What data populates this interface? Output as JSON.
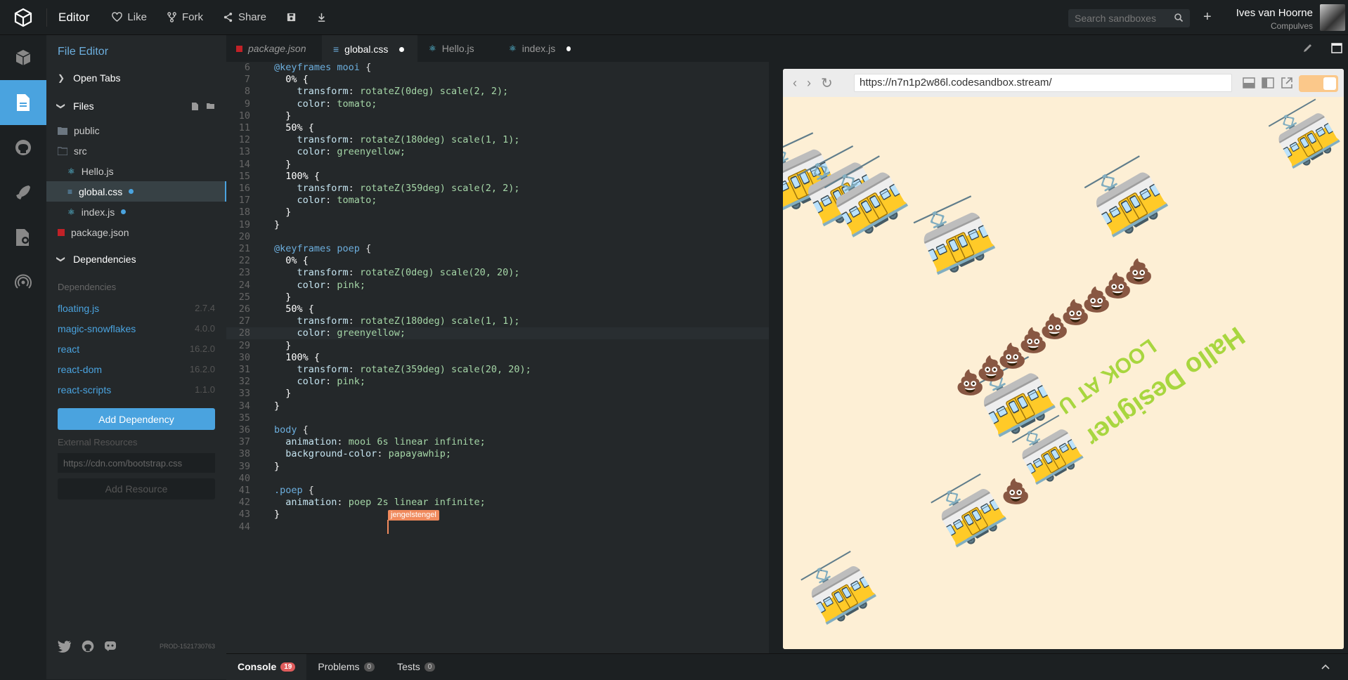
{
  "header": {
    "app_title": "Editor",
    "like": "Like",
    "fork": "Fork",
    "share": "Share",
    "search_placeholder": "Search sandboxes",
    "plus": "+",
    "user_name": "Ives van Hoorne",
    "user_org": "Compulves"
  },
  "sidebar": {
    "title": "File Editor",
    "open_tabs": "Open Tabs",
    "files": "Files",
    "file_items": [
      {
        "name": "public"
      },
      {
        "name": "src"
      },
      {
        "name": "Hello.js"
      },
      {
        "name": "global.css"
      },
      {
        "name": "index.js"
      },
      {
        "name": "package.json"
      }
    ],
    "dependencies_section": "Dependencies",
    "dependencies_label": "Dependencies",
    "dependencies": [
      {
        "name": "floating.js",
        "version": "2.7.4"
      },
      {
        "name": "magic-snowflakes",
        "version": "4.0.0"
      },
      {
        "name": "react",
        "version": "16.2.0"
      },
      {
        "name": "react-dom",
        "version": "16.2.0"
      },
      {
        "name": "react-scripts",
        "version": "1.1.0"
      }
    ],
    "add_dependency": "Add Dependency",
    "external_resources": "External Resources",
    "external_placeholder": "https://cdn.com/bootstrap.css",
    "add_resource": "Add Resource",
    "version_tag": "PROD-1521730763"
  },
  "tabs": [
    {
      "label": "package.json"
    },
    {
      "label": "global.css"
    },
    {
      "label": "Hello.js"
    },
    {
      "label": "index.js"
    }
  ],
  "editor": {
    "collaborator": "jengelstengel",
    "lines": [
      {
        "n": "6",
        "t": "@keyframes mooi {"
      },
      {
        "n": "7",
        "t": "  0% {"
      },
      {
        "n": "8",
        "t": "    transform: rotateZ(0deg) scale(2, 2);"
      },
      {
        "n": "9",
        "t": "    color: tomato;"
      },
      {
        "n": "10",
        "t": "  }"
      },
      {
        "n": "11",
        "t": "  50% {"
      },
      {
        "n": "12",
        "t": "    transform: rotateZ(180deg) scale(1, 1);"
      },
      {
        "n": "13",
        "t": "    color: greenyellow;"
      },
      {
        "n": "14",
        "t": "  }"
      },
      {
        "n": "15",
        "t": "  100% {"
      },
      {
        "n": "16",
        "t": "    transform: rotateZ(359deg) scale(2, 2);"
      },
      {
        "n": "17",
        "t": "    color: tomato;"
      },
      {
        "n": "18",
        "t": "  }"
      },
      {
        "n": "19",
        "t": "}"
      },
      {
        "n": "20",
        "t": ""
      },
      {
        "n": "21",
        "t": "@keyframes poep {"
      },
      {
        "n": "22",
        "t": "  0% {"
      },
      {
        "n": "23",
        "t": "    transform: rotateZ(0deg) scale(20, 20);"
      },
      {
        "n": "24",
        "t": "    color: pink;"
      },
      {
        "n": "25",
        "t": "  }"
      },
      {
        "n": "26",
        "t": "  50% {"
      },
      {
        "n": "27",
        "t": "    transform: rotateZ(180deg) scale(1, 1);"
      },
      {
        "n": "28",
        "t": "    color: greenyellow;"
      },
      {
        "n": "29",
        "t": "  }"
      },
      {
        "n": "30",
        "t": "  100% {"
      },
      {
        "n": "31",
        "t": "    transform: rotateZ(359deg) scale(20, 20);"
      },
      {
        "n": "32",
        "t": "    color: pink;"
      },
      {
        "n": "33",
        "t": "  }"
      },
      {
        "n": "34",
        "t": "}"
      },
      {
        "n": "35",
        "t": ""
      },
      {
        "n": "36",
        "t": "body {"
      },
      {
        "n": "37",
        "t": "  animation: mooi 6s linear infinite;"
      },
      {
        "n": "38",
        "t": "  background-color: papayawhip;"
      },
      {
        "n": "39",
        "t": "}"
      },
      {
        "n": "40",
        "t": ""
      },
      {
        "n": "41",
        "t": ".poep {"
      },
      {
        "n": "42",
        "t": "  animation: poep 2s linear infinite;"
      },
      {
        "n": "43",
        "t": "}"
      },
      {
        "n": "44",
        "t": ""
      }
    ]
  },
  "preview": {
    "url": "https://n7n1p2w86l.codesandbox.stream/",
    "hello": "Hallo Designer",
    "look": "LOOK AT U"
  },
  "bottom": {
    "console": "Console",
    "console_count": "19",
    "problems": "Problems",
    "problems_count": "0",
    "tests": "Tests",
    "tests_count": "0"
  },
  "colors": {
    "accent": "#4aa3df",
    "preview_bg": "#fdefd5",
    "collaborator": "#f08a5d"
  }
}
